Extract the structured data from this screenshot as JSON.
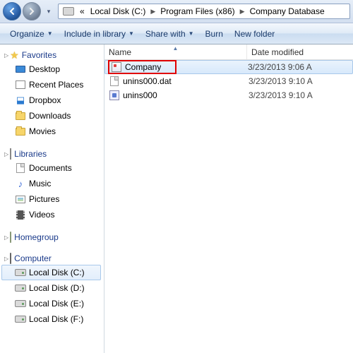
{
  "breadcrumb": {
    "overflow_glyph": "«",
    "segments": [
      "Local Disk (C:)",
      "Program Files (x86)",
      "Company Database"
    ]
  },
  "toolbar": {
    "organize": "Organize",
    "include": "Include in library",
    "share": "Share with",
    "burn": "Burn",
    "newfolder": "New folder"
  },
  "columns": {
    "name": "Name",
    "date": "Date modified"
  },
  "files": [
    {
      "name": "Company",
      "date": "3/23/2013 9:06 A",
      "icon": "db-app",
      "selected": true,
      "highlighted": true
    },
    {
      "name": "unins000.dat",
      "date": "3/23/2013 9:10 A",
      "icon": "page",
      "selected": false,
      "highlighted": false
    },
    {
      "name": "unins000",
      "date": "3/23/2013 9:10 A",
      "icon": "uninst",
      "selected": false,
      "highlighted": false
    }
  ],
  "sidebar": {
    "favorites": {
      "header": "Favorites",
      "items": [
        {
          "label": "Desktop",
          "icon": "desktop"
        },
        {
          "label": "Recent Places",
          "icon": "recent"
        },
        {
          "label": "Dropbox",
          "icon": "dropbox"
        },
        {
          "label": "Downloads",
          "icon": "folder"
        },
        {
          "label": "Movies",
          "icon": "folder"
        }
      ]
    },
    "libraries": {
      "header": "Libraries",
      "items": [
        {
          "label": "Documents",
          "icon": "page"
        },
        {
          "label": "Music",
          "icon": "note"
        },
        {
          "label": "Pictures",
          "icon": "pic"
        },
        {
          "label": "Videos",
          "icon": "film"
        }
      ]
    },
    "homegroup": {
      "header": "Homegroup"
    },
    "computer": {
      "header": "Computer",
      "items": [
        {
          "label": "Local Disk (C:)",
          "icon": "drive",
          "selected": true
        },
        {
          "label": "Local Disk (D:)",
          "icon": "drive"
        },
        {
          "label": "Local Disk (E:)",
          "icon": "drive"
        },
        {
          "label": "Local Disk (F:)",
          "icon": "drive"
        }
      ]
    }
  }
}
